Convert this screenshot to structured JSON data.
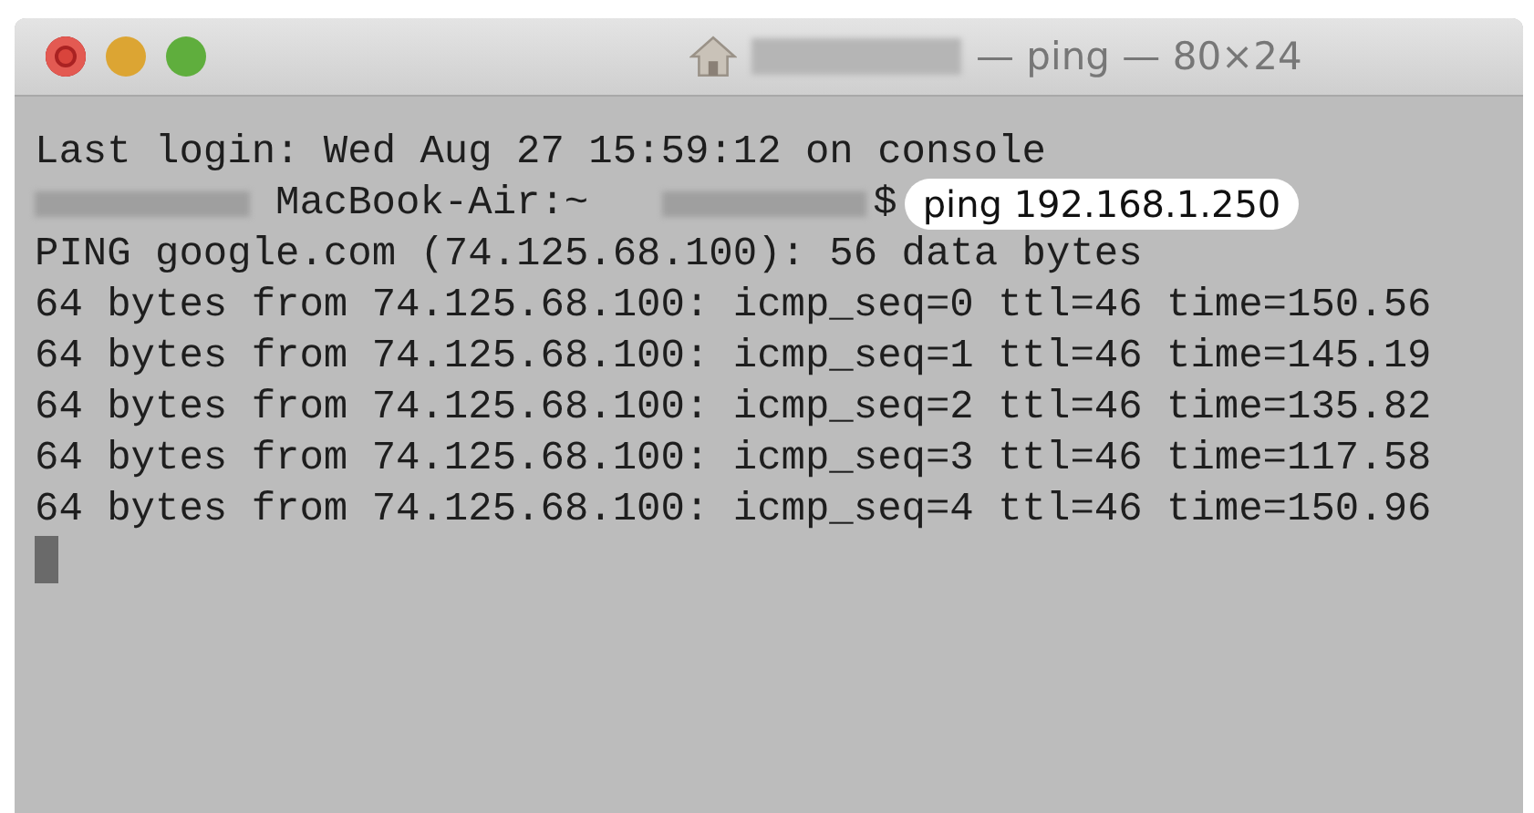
{
  "window": {
    "title": "— ping — 80×24"
  },
  "terminal": {
    "lines": [
      {
        "kind": "text",
        "text": "Last login: Wed Aug 27 15:59:12 on console"
      },
      {
        "kind": "prompt",
        "host": "MacBook-Air:~",
        "symbol": "$",
        "command": "ping 192.168.1.250"
      },
      {
        "kind": "text",
        "text": "PING google.com (74.125.68.100): 56 data bytes"
      },
      {
        "kind": "text",
        "text": "64 bytes from 74.125.68.100: icmp_seq=0 ttl=46 time=150.56"
      },
      {
        "kind": "text",
        "text": "64 bytes from 74.125.68.100: icmp_seq=1 ttl=46 time=145.19"
      },
      {
        "kind": "text",
        "text": "64 bytes from 74.125.68.100: icmp_seq=2 ttl=46 time=135.82"
      },
      {
        "kind": "text",
        "text": "64 bytes from 74.125.68.100: icmp_seq=3 ttl=46 time=117.58"
      },
      {
        "kind": "text",
        "text": "64 bytes from 74.125.68.100: icmp_seq=4 ttl=46 time=150.96"
      },
      {
        "kind": "cursor"
      }
    ]
  }
}
